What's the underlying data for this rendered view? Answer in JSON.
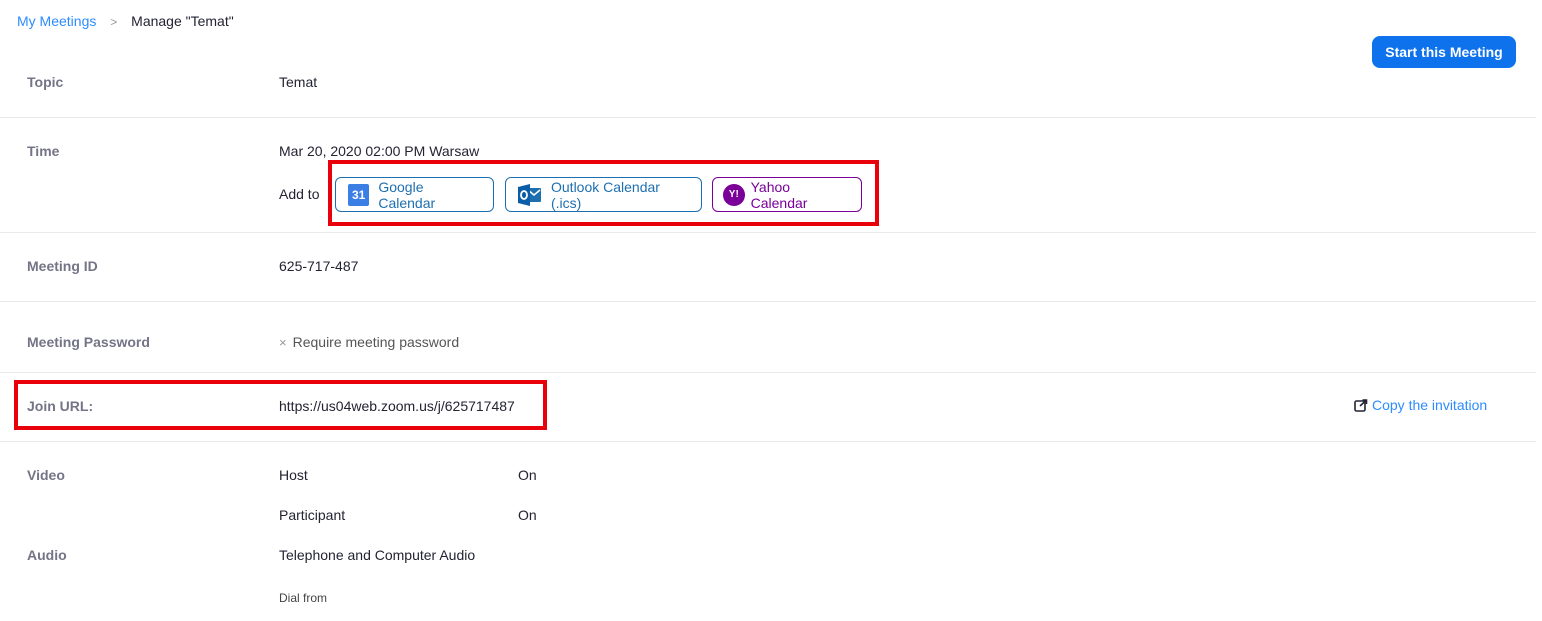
{
  "breadcrumb": {
    "parent": "My Meetings",
    "separator": ">",
    "current": "Manage \"Temat\""
  },
  "header": {
    "start_button": "Start this Meeting"
  },
  "topic": {
    "label": "Topic",
    "value": "Temat"
  },
  "time": {
    "label": "Time",
    "value": "Mar 20, 2020 02:00 PM Warsaw",
    "add_to": "Add to",
    "calendars": {
      "google": "Google Calendar",
      "google_icon_text": "31",
      "outlook": "Outlook Calendar (.ics)",
      "yahoo": "Yahoo Calendar",
      "yahoo_icon_text": "Y!"
    }
  },
  "meeting_id": {
    "label": "Meeting ID",
    "value": "625-717-487"
  },
  "password": {
    "label": "Meeting Password",
    "mark": "×",
    "value": "Require meeting password"
  },
  "join_url": {
    "label": "Join URL:",
    "value": "https://us04web.zoom.us/j/625717487",
    "copy": "Copy the invitation"
  },
  "video": {
    "label": "Video",
    "host_label": "Host",
    "host_value": "On",
    "participant_label": "Participant",
    "participant_value": "On"
  },
  "audio": {
    "label": "Audio",
    "value": "Telephone and Computer Audio",
    "dial_from": "Dial from"
  },
  "colors": {
    "accent": "#0e72ed",
    "link": "#2d8cff",
    "highlight": "#e8000b",
    "yahoo": "#7b0099",
    "outlook": "#1e6fb0"
  }
}
